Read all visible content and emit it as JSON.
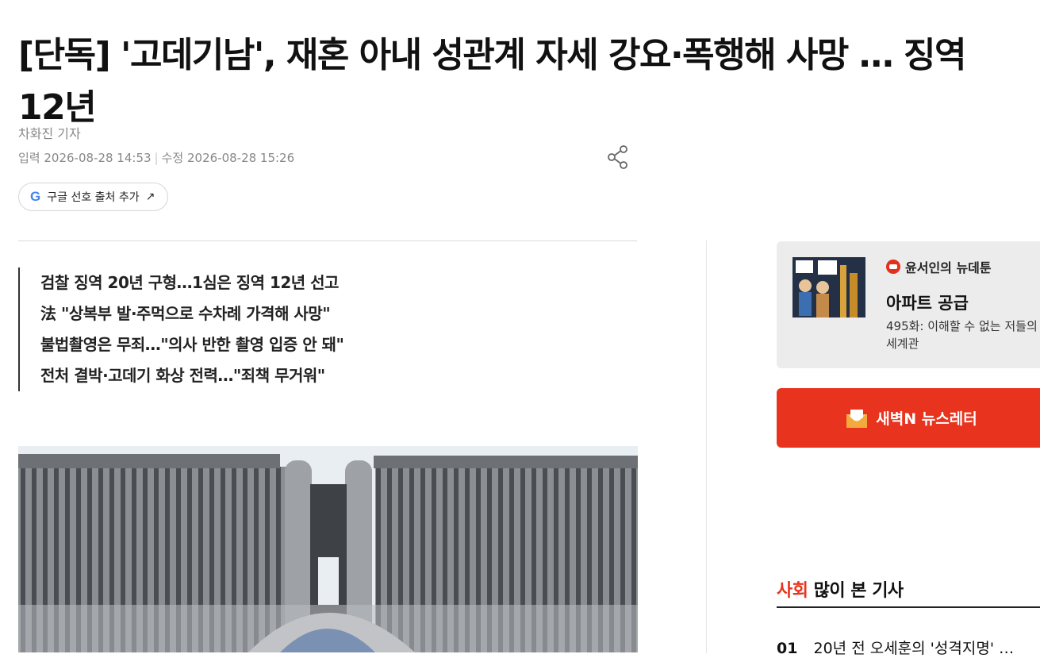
{
  "article": {
    "headline_line1": "[단독] '고데기남', 재혼 아내 성관계 자세 강요·폭행해 사망 … 징역",
    "headline_line2": "12년",
    "reporter": "차화진 기자",
    "published": "입력 2026-08-28 14:53",
    "separator": "|",
    "modified": "수정 2026-08-28 15:26",
    "google_button_label": "구글 선호 출처 추가",
    "google_button_arrow": "↗",
    "google_logo": "G",
    "summary": [
      "검찰 징역 20년 구형…1심은 징역 12년 선고",
      "法 \"상복부 발·주먹으로 수차례 가격해 사망\"",
      "불법촬영은 무죄…\"의사 반한 촬영 입증 안 돼\"",
      "전처 결박·고데기 화상 전력…\"죄책 무거워\""
    ]
  },
  "sidebar": {
    "webtoon": {
      "brand": "윤서인의 뉴데툰",
      "title": "아파트 공급",
      "desc_line1": "495화: 이해할 수 없는 저들의",
      "desc_line2": "세계관"
    },
    "newsletter_label": "새벽N 뉴스레터",
    "most_viewed": {
      "section": "사회",
      "heading": "많이 본 기사",
      "items": [
        {
          "rank": "01",
          "title": "20년 전 오세훈의 '성격지명' …"
        }
      ]
    }
  },
  "colors": {
    "accent": "#e8331e",
    "text": "#111111",
    "muted": "#888888"
  },
  "icons": {
    "share": "share-icon",
    "google": "google-logo-icon",
    "newsletter": "envelope-icon"
  }
}
